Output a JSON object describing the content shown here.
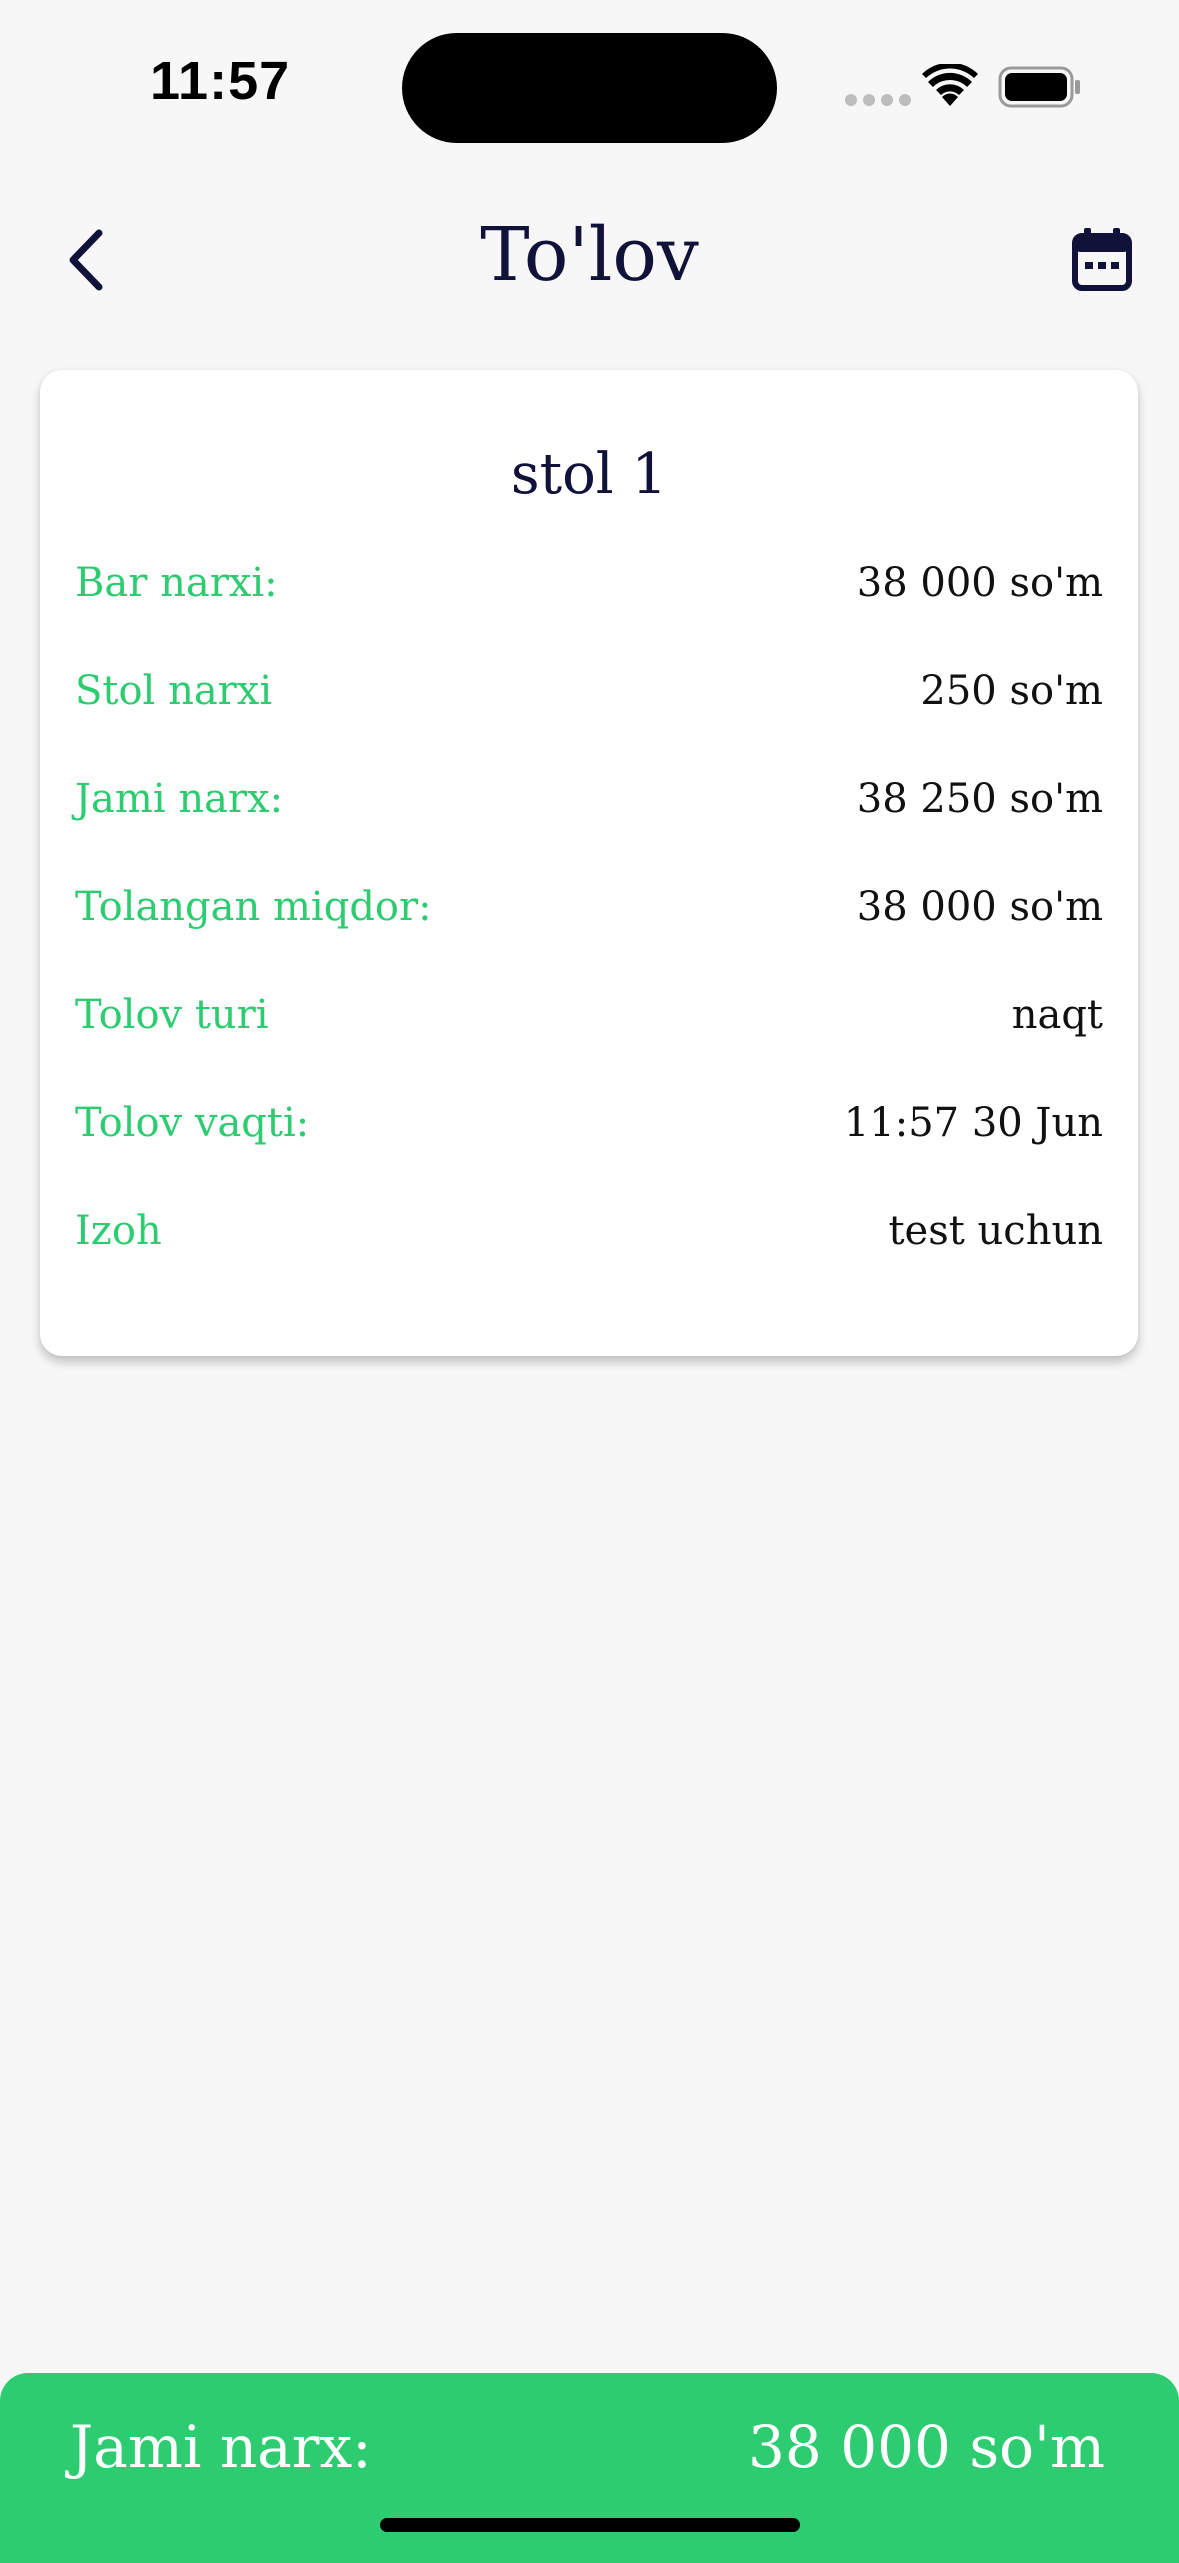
{
  "status_bar": {
    "time": "11:57",
    "icons": [
      "cellular-signal-icon",
      "wifi-icon",
      "battery-icon"
    ]
  },
  "header": {
    "title": "To'lov",
    "back_icon": "chevron-left-icon",
    "calendar_icon": "calendar-icon"
  },
  "card": {
    "title": "stol 1",
    "rows": [
      {
        "label": "Bar narxi:",
        "value": "38 000 so'm"
      },
      {
        "label": "Stol narxi",
        "value": "250 so'm"
      },
      {
        "label": "Jami narx:",
        "value": "38 250 so'm"
      },
      {
        "label": "Tolangan miqdor:",
        "value": "38 000 so'm"
      },
      {
        "label": "Tolov turi",
        "value": "naqt"
      },
      {
        "label": "Tolov vaqti:",
        "value": "11:57 30 Jun"
      },
      {
        "label": "Izoh",
        "value": "test uchun"
      }
    ]
  },
  "footer": {
    "label": "Jami narx:",
    "value": "38 000 so'm"
  },
  "colors": {
    "accent": "#2ecc71",
    "title": "#10123a",
    "background": "#f7f7f7"
  }
}
